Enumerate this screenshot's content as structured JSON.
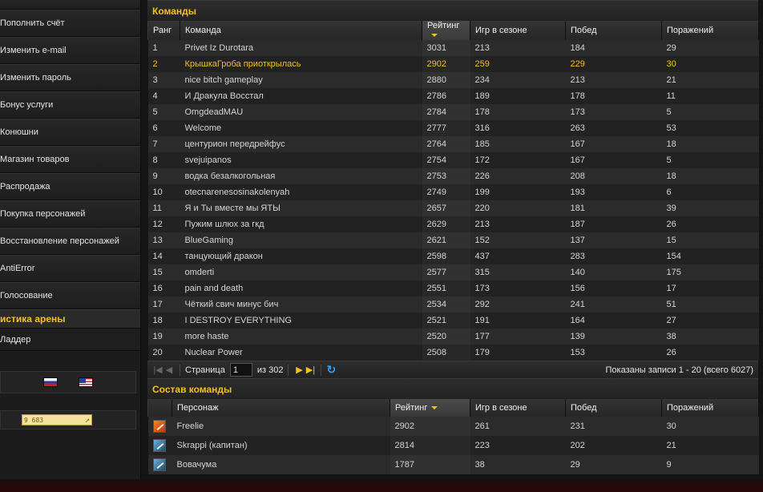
{
  "sidebar": {
    "items": [
      {
        "label": ""
      },
      {
        "label": "Пополнить счёт"
      },
      {
        "label": "Изменить e-mail"
      },
      {
        "label": "Изменить пароль"
      },
      {
        "label": "Бонус услуги"
      },
      {
        "label": "Конюшни"
      },
      {
        "label": "Магазин товаров"
      },
      {
        "label": "Распродажа"
      },
      {
        "label": "Покупка персонажей"
      },
      {
        "label": "Восстановление персонажей"
      },
      {
        "label": "AntiError"
      },
      {
        "label": "Голосование"
      }
    ],
    "section_title": "истика арены",
    "section_items": [
      {
        "label": "Ладдер"
      }
    ],
    "counter_value": "9 683",
    "flags": [
      "russian-flag-icon",
      "us-flag-icon"
    ]
  },
  "teams": {
    "title": "Команды",
    "columns": [
      "Ранг",
      "Команда",
      "Рейтинг",
      "Игр в сезоне",
      "Побед",
      "Поражений"
    ],
    "rows": [
      {
        "rank": "1",
        "name": "Privet Iz Durotara",
        "rating": "3031",
        "games": "213",
        "wins": "184",
        "losses": "29"
      },
      {
        "rank": "2",
        "name": "КрышкаГроба приоткрылась",
        "rating": "2902",
        "games": "259",
        "wins": "229",
        "losses": "30",
        "highlight": true
      },
      {
        "rank": "3",
        "name": "nice bitch gameplay",
        "rating": "2880",
        "games": "234",
        "wins": "213",
        "losses": "21"
      },
      {
        "rank": "4",
        "name": "И Дракула Восстал",
        "rating": "2786",
        "games": "189",
        "wins": "178",
        "losses": "11"
      },
      {
        "rank": "5",
        "name": "OmgdeadMAU",
        "rating": "2784",
        "games": "178",
        "wins": "173",
        "losses": "5"
      },
      {
        "rank": "6",
        "name": "Welcome",
        "rating": "2777",
        "games": "316",
        "wins": "263",
        "losses": "53"
      },
      {
        "rank": "7",
        "name": "центурион передрейфус",
        "rating": "2764",
        "games": "185",
        "wins": "167",
        "losses": "18"
      },
      {
        "rank": "8",
        "name": "svejuipanos",
        "rating": "2754",
        "games": "172",
        "wins": "167",
        "losses": "5"
      },
      {
        "rank": "9",
        "name": "водка безалкогольная",
        "rating": "2753",
        "games": "226",
        "wins": "208",
        "losses": "18"
      },
      {
        "rank": "10",
        "name": "otecnarenesosinakolenyah",
        "rating": "2749",
        "games": "199",
        "wins": "193",
        "losses": "6"
      },
      {
        "rank": "11",
        "name": "Я и Ты вместе мы ЯТЫ",
        "rating": "2657",
        "games": "220",
        "wins": "181",
        "losses": "39"
      },
      {
        "rank": "12",
        "name": "Пужим шлюх за гкд",
        "rating": "2629",
        "games": "213",
        "wins": "187",
        "losses": "26"
      },
      {
        "rank": "13",
        "name": "BlueGaming",
        "rating": "2621",
        "games": "152",
        "wins": "137",
        "losses": "15"
      },
      {
        "rank": "14",
        "name": "танцующий дракон",
        "rating": "2598",
        "games": "437",
        "wins": "283",
        "losses": "154"
      },
      {
        "rank": "15",
        "name": "omderti",
        "rating": "2577",
        "games": "315",
        "wins": "140",
        "losses": "175"
      },
      {
        "rank": "16",
        "name": "pain and death",
        "rating": "2551",
        "games": "173",
        "wins": "156",
        "losses": "17"
      },
      {
        "rank": "17",
        "name": "Чёткий свич минус бич",
        "rating": "2534",
        "games": "292",
        "wins": "241",
        "losses": "51"
      },
      {
        "rank": "18",
        "name": "I DESTROY EVERYTHING",
        "rating": "2521",
        "games": "191",
        "wins": "164",
        "losses": "27"
      },
      {
        "rank": "19",
        "name": "more haste",
        "rating": "2520",
        "games": "177",
        "wins": "139",
        "losses": "38"
      },
      {
        "rank": "20",
        "name": "Nuclear Power",
        "rating": "2508",
        "games": "179",
        "wins": "153",
        "losses": "26"
      }
    ]
  },
  "pager": {
    "page_label": "Страница",
    "page_value": "1",
    "of_label": "из 302",
    "info": "Показаны записи 1 - 20 (всего 6027)"
  },
  "roster": {
    "title": "Состав команды",
    "columns": [
      "",
      "Персонаж",
      "Рейтинг",
      "Игр в сезоне",
      "Побед",
      "Поражений"
    ],
    "rows": [
      {
        "icon": "mage-class-icon",
        "name": "Freelie",
        "rating": "2902",
        "games": "261",
        "wins": "231",
        "losses": "30"
      },
      {
        "icon": "warrior-class-icon",
        "name": "Skrappi (капитан)",
        "rating": "2814",
        "games": "223",
        "wins": "202",
        "losses": "21"
      },
      {
        "icon": "warrior-class-icon",
        "name": "Вовачума",
        "rating": "1787",
        "games": "38",
        "wins": "29",
        "losses": "9"
      }
    ]
  },
  "colors": {
    "accent": "#f2c11c",
    "link_blue": "#3a9ae8"
  }
}
